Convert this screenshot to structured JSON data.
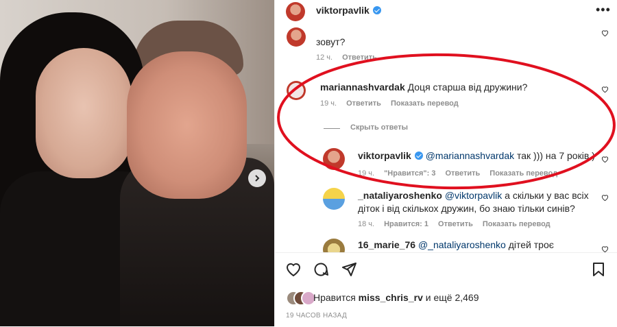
{
  "post": {
    "username": "viktorpavlik"
  },
  "comments": [
    {
      "text_partial": "зовут?",
      "time": "12 ч.",
      "reply": "Ответить"
    },
    {
      "username": "mariannashvardak",
      "text": "Доця старша від дружини?",
      "time": "19 ч.",
      "reply": "Ответить",
      "translate": "Показать перевод"
    },
    {
      "hide_replies": "Скрыть ответы"
    },
    {
      "username": "viktorpavlik",
      "mention": "@mariannashvardak",
      "text": "так ))) на 7 років )",
      "time": "19 ч.",
      "likes": "\"Нравится\": 3",
      "reply": "Ответить",
      "translate": "Показать перевод"
    },
    {
      "username": "_nataliyaroshenko",
      "mention": "@viktorpavlik",
      "text1": "а скільки у вас всіх",
      "text2": "діток і від скількох дружин, бо знаю тільки синів?",
      "time": "18 ч.",
      "likes": "Нравится: 1",
      "reply": "Ответить",
      "translate": "Показать перевод"
    },
    {
      "username": "16_marie_76",
      "mention": "@_nataliyaroshenko",
      "text": "дітей троє"
    }
  ],
  "footer": {
    "likes_prefix": "Нравится",
    "likes_user": "miss_chris_rv",
    "likes_suffix": "и ещё 2,469",
    "date": "19 ЧАСОВ НАЗАД"
  },
  "icons": [
    "heart-icon",
    "comment-icon",
    "share-icon",
    "bookmark-icon",
    "more-icon",
    "verified-icon",
    "chevron-right-icon"
  ],
  "colors": {
    "verified": "#3897f0",
    "annotation_circle": "#e0101f",
    "mention": "#00376b",
    "muted": "#8e8e8e"
  }
}
